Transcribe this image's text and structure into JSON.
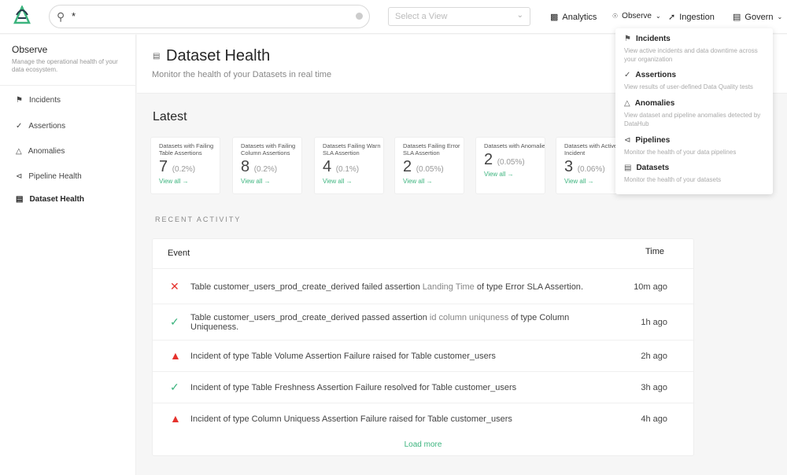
{
  "search": {
    "value": "*",
    "placeholder": ""
  },
  "view_select": {
    "placeholder": "Select a View"
  },
  "nav": {
    "analytics": "Analytics",
    "observe": "Observe",
    "ingestion": "Ingestion",
    "govern": "Govern"
  },
  "sidebar": {
    "title": "Observe",
    "description": "Manage the operational health of your data ecosystem.",
    "items": [
      {
        "label": "Incidents"
      },
      {
        "label": "Assertions"
      },
      {
        "label": "Anomalies"
      },
      {
        "label": "Pipeline Health"
      },
      {
        "label": "Dataset Health"
      }
    ]
  },
  "header": {
    "title": "Dataset Health",
    "subtitle": "Monitor the health of your Datasets in real time"
  },
  "latest": {
    "title": "Latest",
    "cards": [
      {
        "title": "Datasets with Failing Table Assertions",
        "count": "7",
        "pct": "(0.2%)",
        "link": "View all →"
      },
      {
        "title": "Datasets with Failing Column Assertions",
        "count": "8",
        "pct": "(0.2%)",
        "link": "View all →"
      },
      {
        "title": "Datasets Failing Warn SLA Assertion",
        "count": "4",
        "pct": "(0.1%)",
        "link": "View all →"
      },
      {
        "title": "Datasets Failing Error SLA Assertion",
        "count": "2",
        "pct": "(0.05%)",
        "link": "View all →"
      },
      {
        "title": "Datasets with Anomalies",
        "count": "2",
        "pct": "(0.05%)",
        "link": "View all →"
      },
      {
        "title": "Datasets with Active Incident",
        "count": "3",
        "pct": "(0.06%)",
        "link": "View all →"
      }
    ]
  },
  "activity": {
    "title": "RECENT ACTIVITY",
    "col_event": "Event",
    "col_time": "Time",
    "load_more": "Load more",
    "colors": {
      "fail": "#e5322d",
      "pass": "#3cb47e"
    },
    "rows": [
      {
        "icon": "x-icon",
        "parts": [
          [
            "Table ",
            ""
          ],
          [
            "customer_users_prod_create_derived",
            "b"
          ],
          [
            " failed assertion ",
            ""
          ],
          [
            "Landing Time",
            "lt"
          ],
          [
            " of type ",
            ""
          ],
          [
            "Error SLA Assertion",
            "b"
          ],
          [
            ".",
            ""
          ]
        ],
        "time": "10m ago"
      },
      {
        "icon": "check-icon",
        "parts": [
          [
            "Table ",
            ""
          ],
          [
            "customer_users_prod_create_derived",
            "b"
          ],
          [
            " passed assertion ",
            ""
          ],
          [
            "id column uniquness",
            "lt"
          ],
          [
            " of type ",
            ""
          ],
          [
            "Column Uniqueness",
            "b"
          ],
          [
            ".",
            ""
          ]
        ],
        "time": "1h ago"
      },
      {
        "icon": "warning-icon",
        "parts": [
          [
            "Incident",
            "b"
          ],
          [
            " of type ",
            ""
          ],
          [
            "Table Volume Assertion Failure",
            "b"
          ],
          [
            " raised for Table ",
            ""
          ],
          [
            "customer_users",
            "b"
          ]
        ],
        "time": "2h ago"
      },
      {
        "icon": "check-icon",
        "parts": [
          [
            "Incident",
            "b"
          ],
          [
            " of type ",
            ""
          ],
          [
            "Table Freshness Assertion Failure",
            "b"
          ],
          [
            " resolved for Table ",
            ""
          ],
          [
            "customer_users",
            "b"
          ]
        ],
        "time": "3h ago"
      },
      {
        "icon": "warning-icon",
        "parts": [
          [
            "Incident",
            "b"
          ],
          [
            " of type ",
            ""
          ],
          [
            "Column Uniquess Assertion Failure",
            "b"
          ],
          [
            " raised for Table ",
            ""
          ],
          [
            "customer_users",
            "b"
          ]
        ],
        "time": "4h ago"
      }
    ]
  },
  "observe_menu": [
    {
      "label": "Incidents",
      "desc": "View active incidents and data downtime across your organization",
      "icon": "flag-icon"
    },
    {
      "label": "Assertions",
      "desc": "View results of user-defined Data Quality tests",
      "icon": "check-circle-icon"
    },
    {
      "label": "Anomalies",
      "desc": "View dataset and pipeline anomalies detected by DataHub",
      "icon": "warning-icon"
    },
    {
      "label": "Pipelines",
      "desc": "Monitor the health of your data pipelines",
      "icon": "share-icon"
    },
    {
      "label": "Datasets",
      "desc": "Monitor the health of your datasets",
      "icon": "table-icon"
    }
  ]
}
